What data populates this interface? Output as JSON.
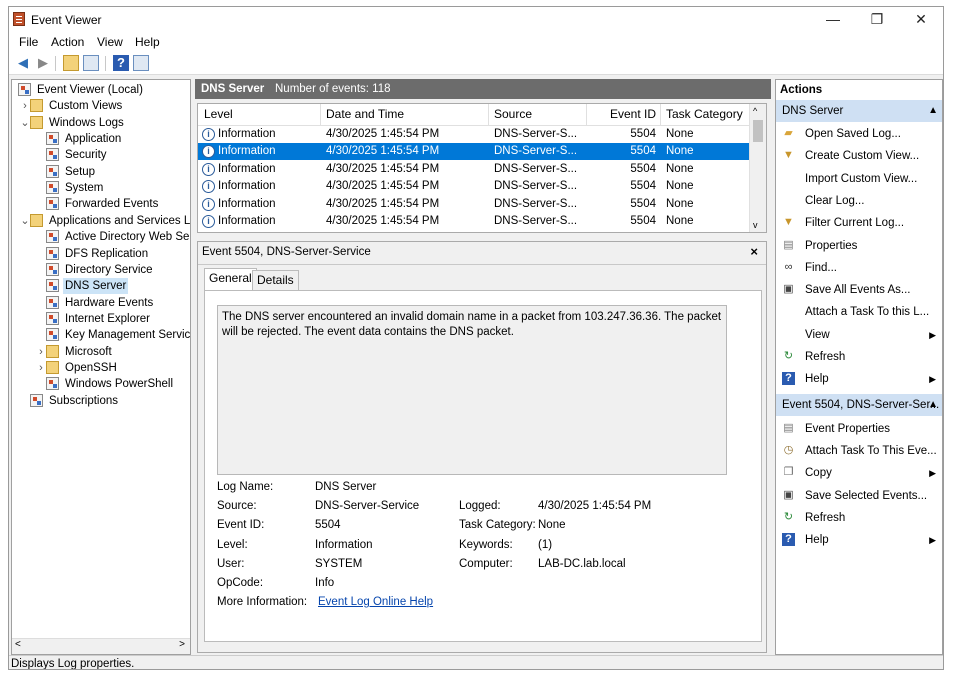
{
  "window": {
    "title": "Event Viewer",
    "minimize": "—",
    "restore": "❐",
    "close": "✕"
  },
  "menu": [
    "File",
    "Action",
    "View",
    "Help"
  ],
  "tree": [
    {
      "label": "Event Viewer (Local)",
      "level": 0,
      "icon": "event-viewer-icon"
    },
    {
      "label": "Custom Views",
      "level": 1,
      "icon": "folder-icon",
      "expander": ">"
    },
    {
      "label": "Windows Logs",
      "level": 1,
      "icon": "folder-icon",
      "expander": "v"
    },
    {
      "label": "Application",
      "level": 2,
      "icon": "log-icon"
    },
    {
      "label": "Security",
      "level": 2,
      "icon": "log-icon"
    },
    {
      "label": "Setup",
      "level": 2,
      "icon": "log-icon"
    },
    {
      "label": "System",
      "level": 2,
      "icon": "log-icon"
    },
    {
      "label": "Forwarded Events",
      "level": 2,
      "icon": "log-icon"
    },
    {
      "label": "Applications and Services Lo",
      "level": 1,
      "icon": "folder-icon",
      "expander": "v"
    },
    {
      "label": "Active Directory Web Ser",
      "level": 2,
      "icon": "log-icon"
    },
    {
      "label": "DFS Replication",
      "level": 2,
      "icon": "log-icon"
    },
    {
      "label": "Directory Service",
      "level": 2,
      "icon": "log-icon"
    },
    {
      "label": "DNS Server",
      "level": 2,
      "icon": "log-icon",
      "selected": true
    },
    {
      "label": "Hardware Events",
      "level": 2,
      "icon": "log-icon"
    },
    {
      "label": "Internet Explorer",
      "level": 2,
      "icon": "log-icon"
    },
    {
      "label": "Key Management Service",
      "level": 2,
      "icon": "log-icon"
    },
    {
      "label": "Microsoft",
      "level": 2,
      "icon": "folder-icon",
      "expander": ">"
    },
    {
      "label": "OpenSSH",
      "level": 2,
      "icon": "folder-icon",
      "expander": ">"
    },
    {
      "label": "Windows PowerShell",
      "level": 2,
      "icon": "log-icon"
    },
    {
      "label": "Subscriptions",
      "level": 1,
      "icon": "subscriptions-icon"
    }
  ],
  "log_header": {
    "name": "DNS Server",
    "count": "Number of events: 118"
  },
  "grid": {
    "columns": [
      "Level",
      "Date and Time",
      "Source",
      "Event ID",
      "Task Category"
    ],
    "rows": [
      [
        "Information",
        "4/30/2025 1:45:54 PM",
        "DNS-Server-S...",
        "5504",
        "None"
      ],
      [
        "Information",
        "4/30/2025 1:45:54 PM",
        "DNS-Server-S...",
        "5504",
        "None"
      ],
      [
        "Information",
        "4/30/2025 1:45:54 PM",
        "DNS-Server-S...",
        "5504",
        "None"
      ],
      [
        "Information",
        "4/30/2025 1:45:54 PM",
        "DNS-Server-S...",
        "5504",
        "None"
      ],
      [
        "Information",
        "4/30/2025 1:45:54 PM",
        "DNS-Server-S...",
        "5504",
        "None"
      ],
      [
        "Information",
        "4/30/2025 1:45:54 PM",
        "DNS-Server-S...",
        "5504",
        "None"
      ]
    ],
    "selected_row": 1
  },
  "detail": {
    "title": "Event 5504, DNS-Server-Service",
    "close": "×",
    "tabs": [
      "General",
      "Details"
    ],
    "message": "The DNS server encountered an invalid domain name in a packet from 103.247.36.36. The packet will be rejected. The event data contains the DNS packet.",
    "labels": {
      "log_name": "Log Name:",
      "source": "Source:",
      "event_id": "Event ID:",
      "level": "Level:",
      "user": "User:",
      "opcode": "OpCode:",
      "more_info": "More Information:",
      "logged": "Logged:",
      "task_category": "Task Category:",
      "keywords": "Keywords:",
      "computer": "Computer:"
    },
    "values": {
      "log_name": "DNS Server",
      "source": "DNS-Server-Service",
      "event_id": "5504",
      "level": "Information",
      "user": "SYSTEM",
      "opcode": "Info",
      "more_info": "Event Log Online Help",
      "logged": "4/30/2025 1:45:54 PM",
      "task_category": "None",
      "keywords": "(1)",
      "computer": "LAB-DC.lab.local"
    }
  },
  "actions": {
    "title": "Actions",
    "section1": "DNS Server",
    "items1": [
      {
        "label": "Open Saved Log...",
        "icon": "open-folder-icon"
      },
      {
        "label": "Create Custom View...",
        "icon": "filter-icon"
      },
      {
        "label": "Import Custom View...",
        "icon": ""
      },
      {
        "label": "Clear Log...",
        "icon": ""
      },
      {
        "label": "Filter Current Log...",
        "icon": "filter-icon"
      },
      {
        "label": "Properties",
        "icon": "properties-icon"
      },
      {
        "label": "Find...",
        "icon": "binoculars-icon"
      },
      {
        "label": "Save All Events As...",
        "icon": "save-icon"
      },
      {
        "label": "Attach a Task To this L...",
        "icon": ""
      },
      {
        "label": "View",
        "icon": "",
        "submenu": true
      },
      {
        "label": "Refresh",
        "icon": "refresh-icon"
      },
      {
        "label": "Help",
        "icon": "help-icon",
        "submenu": true
      }
    ],
    "section2": "Event 5504, DNS-Server-Ser...",
    "items2": [
      {
        "label": "Event Properties",
        "icon": "properties-icon"
      },
      {
        "label": "Attach Task To This Eve...",
        "icon": "task-icon"
      },
      {
        "label": "Copy",
        "icon": "copy-icon",
        "submenu": true
      },
      {
        "label": "Save Selected Events...",
        "icon": "save-icon"
      },
      {
        "label": "Refresh",
        "icon": "refresh-icon"
      },
      {
        "label": "Help",
        "icon": "help-icon",
        "submenu": true
      }
    ]
  },
  "status": "Displays Log properties.",
  "colors": {
    "selection": "#0078d7",
    "tree_selection": "#cce4f7",
    "header_bar": "#6c6c6c",
    "section_bar": "#cfe0f3",
    "link": "#0645ad"
  }
}
